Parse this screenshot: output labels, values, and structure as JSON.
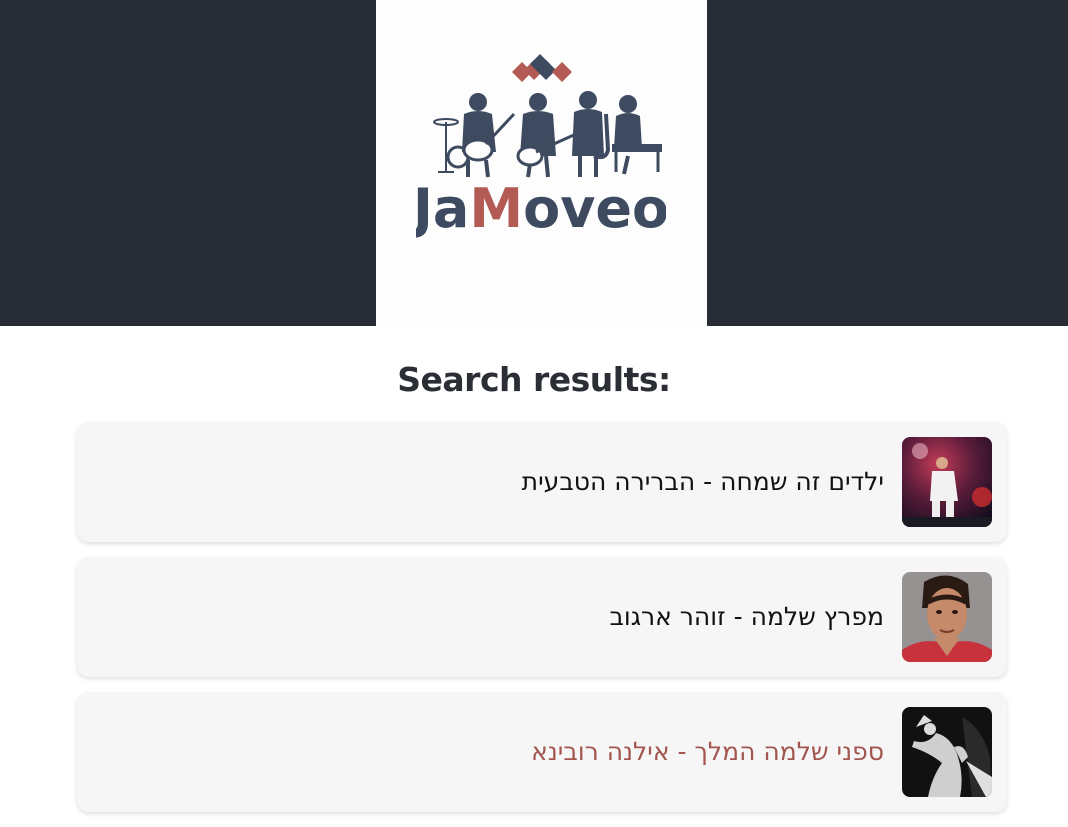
{
  "brand": {
    "name_part1": "Ja",
    "name_part2": "M",
    "name_part3": "oveo",
    "colors": {
      "primary": "#3d4a5f",
      "accent": "#b25a53",
      "header_bg": "#282c34"
    }
  },
  "results": {
    "heading": "Search results:",
    "items": [
      {
        "title": "ילדים זה שמחה - הברירה הטבעית",
        "thumbnail": "concert-photo"
      },
      {
        "title": "מפרץ שלמה - זוהר ארגוב",
        "thumbnail": "singer-portrait"
      },
      {
        "title": "ספני שלמה המלך - אילנה רובינא",
        "thumbnail": "singer-silhouette",
        "highlighted": true
      }
    ]
  }
}
